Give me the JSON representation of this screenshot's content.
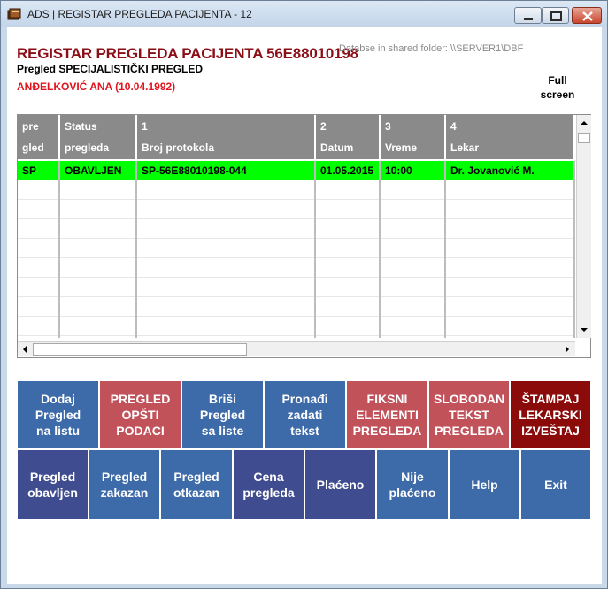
{
  "window": {
    "title": "ADS | REGISTAR PREGLEDA PACIJENTA  -  12"
  },
  "header": {
    "title": "REGISTAR PREGLEDA PACIJENTA 56E88010198",
    "folder": "Databse in shared folder: \\\\SERVER1\\DBF",
    "subtitle": "Pregled SPECIJALISTIČKI PREGLED",
    "patient": "ANĐELKOVIĆ ANA  (10.04.1992)",
    "fullscreen_line1": "Full",
    "fullscreen_line2": "screen"
  },
  "grid": {
    "columns": [
      {
        "l1": "pre",
        "l2": "gled"
      },
      {
        "l1": "Status",
        "l2": "pregleda"
      },
      {
        "l1": "1",
        "l2": "Broj protokola"
      },
      {
        "l1": "2",
        "l2": "Datum"
      },
      {
        "l1": "3",
        "l2": "Vreme"
      },
      {
        "l1": "4",
        "l2": "Lekar"
      }
    ],
    "rows": [
      [
        "SP",
        "OBAVLJEN",
        "SP-56E88010198-044",
        "01.05.2015",
        "10:00",
        "Dr. Jovanović M."
      ]
    ]
  },
  "buttons_row1": [
    {
      "name": "add-exam-button",
      "label": "Dodaj\nPregled\nna listu",
      "color": "#3d6aa8"
    },
    {
      "name": "general-data-button",
      "label": "PREGLED\nOPŠTI\nPODACI",
      "color": "#c2525a"
    },
    {
      "name": "delete-exam-button",
      "label": "Briši\nPregled\nsa liste",
      "color": "#3d6aa8"
    },
    {
      "name": "find-text-button",
      "label": "Pronađi\nzadati\ntekst",
      "color": "#3d6aa8"
    },
    {
      "name": "fixed-elements-button",
      "label": "FIKSNI\nELEMENTI\nPREGLEDA",
      "color": "#c2525a"
    },
    {
      "name": "free-text-button",
      "label": "SLOBODAN\nTEKST\nPREGLEDA",
      "color": "#c2525a"
    },
    {
      "name": "print-report-button",
      "label": "ŠTAMPAJ\nLEKARSKI\nIZVEŠTAJ",
      "color": "#8b0a0a"
    }
  ],
  "buttons_row2": [
    {
      "name": "exam-done-button",
      "label": "Pregled\nobavljen",
      "color": "#3f4c8f"
    },
    {
      "name": "exam-scheduled-button",
      "label": "Pregled\nzakazan",
      "color": "#3d6aa8"
    },
    {
      "name": "exam-cancelled-button",
      "label": "Pregled\notkazan",
      "color": "#3d6aa8"
    },
    {
      "name": "exam-price-button",
      "label": "Cena\npregleda",
      "color": "#3f4c8f"
    },
    {
      "name": "paid-button",
      "label": "Plaćeno",
      "color": "#3f4c8f"
    },
    {
      "name": "not-paid-button",
      "label": "Nije\nplaćeno",
      "color": "#3d6aa8"
    },
    {
      "name": "help-button",
      "label": "Help",
      "color": "#3d6aa8"
    },
    {
      "name": "exit-button",
      "label": "Exit",
      "color": "#3d6aa8"
    }
  ]
}
